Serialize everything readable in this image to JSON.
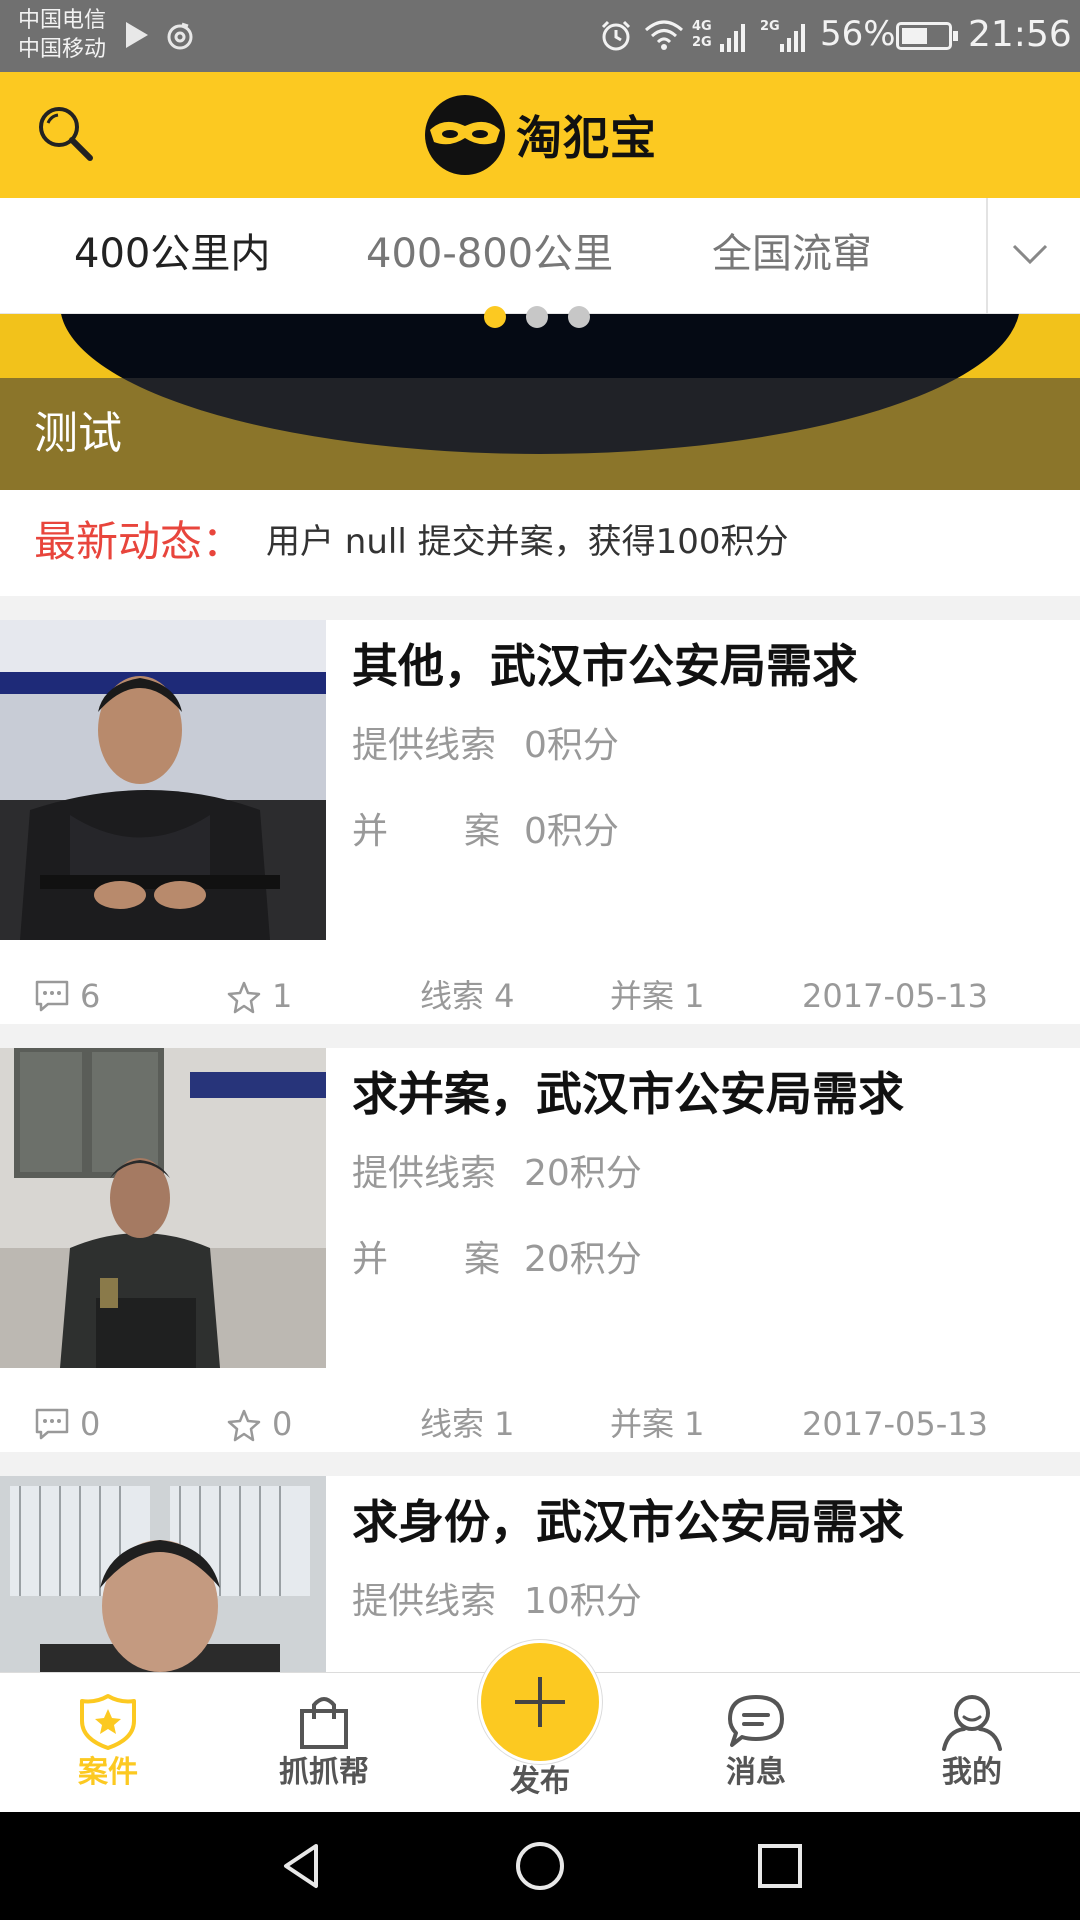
{
  "status_bar": {
    "carrier_1": "中国电信",
    "carrier_2": "中国移动",
    "network_1": "4G 2G",
    "network_2": "2G",
    "battery_percent": "56%",
    "battery_level": 0.56,
    "time": "21:56",
    "icons": [
      "play-icon",
      "netease-music-icon",
      "alarm-icon",
      "wifi-icon",
      "cell-signal-icon",
      "battery-icon"
    ]
  },
  "header": {
    "app_title": "淘犯宝",
    "accent_color": "#fcc921"
  },
  "tabs": {
    "items": [
      "400公里内",
      "400-800公里",
      "全国流窜"
    ],
    "active_index": 0
  },
  "banner": {
    "caption": "测试",
    "page_count": 3,
    "active_page": 1
  },
  "news": {
    "label": "最新动态：",
    "text": "用户 null 提交并案，获得100积分",
    "label_color": "#e8453c"
  },
  "cases": [
    {
      "title": "其他，武汉市公安局需求",
      "clue_label": "提供线索",
      "clue_points": "0积分",
      "merge_label_1": "并",
      "merge_label_2": "案",
      "merge_points": "0积分",
      "comments": "6",
      "favorites": "1",
      "clues_count": "线索 4",
      "merges_count": "并案 1",
      "date": "2017-05-13"
    },
    {
      "title": "求并案，武汉市公安局需求",
      "clue_label": "提供线索",
      "clue_points": "20积分",
      "merge_label_1": "并",
      "merge_label_2": "案",
      "merge_points": "20积分",
      "comments": "0",
      "favorites": "0",
      "clues_count": "线索 1",
      "merges_count": "并案 1",
      "date": "2017-05-13"
    },
    {
      "title": "求身份，武汉市公安局需求",
      "clue_label": "提供线索",
      "clue_points": "10积分"
    }
  ],
  "bottom_nav": {
    "items": [
      {
        "label": "案件",
        "icon": "star-badge-icon",
        "active": true
      },
      {
        "label": "抓抓帮",
        "icon": "shopping-bag-icon",
        "active": false
      },
      {
        "label": "发布",
        "icon": "plus-icon",
        "active": false
      },
      {
        "label": "消息",
        "icon": "chat-bubble-icon",
        "active": false
      },
      {
        "label": "我的",
        "icon": "user-icon",
        "active": false
      }
    ]
  },
  "system_nav": {
    "icons": [
      "back-icon",
      "home-icon",
      "recents-icon"
    ]
  }
}
